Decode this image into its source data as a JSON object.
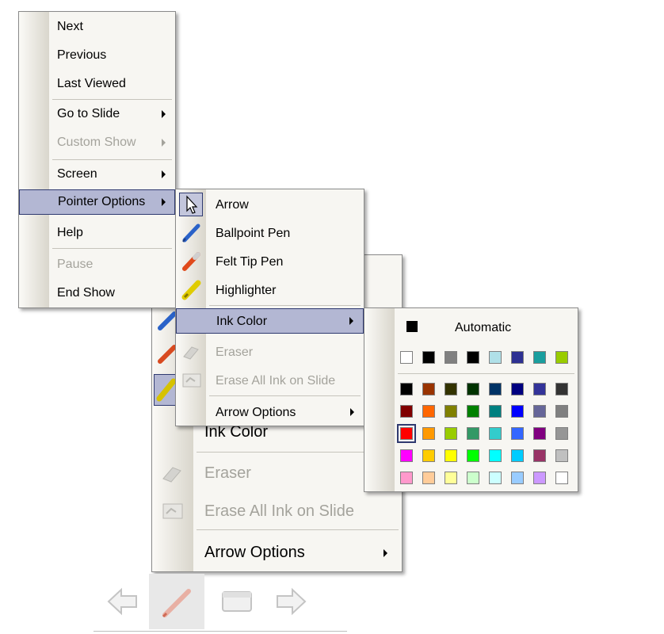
{
  "main_menu": {
    "items": [
      {
        "label": "Next",
        "enabled": true
      },
      {
        "label": "Previous",
        "enabled": true
      },
      {
        "label": "Last Viewed",
        "enabled": true
      },
      {
        "label": "Go to Slide",
        "enabled": true,
        "submenu": true
      },
      {
        "label": "Custom Show",
        "enabled": false,
        "submenu": true
      },
      {
        "label": "Screen",
        "enabled": true,
        "submenu": true
      },
      {
        "label": "Pointer Options",
        "enabled": true,
        "submenu": true,
        "highlighted": true
      },
      {
        "label": "Help",
        "enabled": true
      },
      {
        "label": "Pause",
        "enabled": false
      },
      {
        "label": "End Show",
        "enabled": true
      }
    ]
  },
  "pointer_menu": {
    "items": [
      {
        "label": "Arrow",
        "icon": "arrow-cursor-icon",
        "checked": true
      },
      {
        "label": "Ballpoint Pen",
        "icon": "ballpoint-pen-icon"
      },
      {
        "label": "Felt Tip Pen",
        "icon": "felt-tip-pen-icon"
      },
      {
        "label": "Highlighter",
        "icon": "highlighter-icon"
      },
      {
        "label": "Ink Color",
        "submenu": true,
        "highlighted": true
      },
      {
        "label": "Eraser",
        "icon": "eraser-icon",
        "enabled": false
      },
      {
        "label": "Erase All Ink on Slide",
        "icon": "erase-all-icon",
        "enabled": false
      },
      {
        "label": "Arrow Options",
        "submenu": true
      }
    ]
  },
  "back_menu": {
    "items": [
      {
        "label": "Ink Color",
        "submenu": true
      },
      {
        "label": "Eraser",
        "icon": "eraser-icon",
        "enabled": false
      },
      {
        "label": "Erase All Ink on Slide",
        "icon": "erase-all-icon",
        "enabled": false
      },
      {
        "label": "Arrow Options",
        "submenu": true
      }
    ]
  },
  "ink_color": {
    "automatic_label": "Automatic",
    "automatic_color": "#000000",
    "theme_row": [
      "#ffffff",
      "#000000",
      "#808080",
      "#000000",
      "#b0e0e8",
      "#2e3192",
      "#1a9e9e",
      "#99cc00"
    ],
    "grid": [
      [
        "#000000",
        "#993300",
        "#333300",
        "#003300",
        "#003366",
        "#000080",
        "#333399",
        "#333333"
      ],
      [
        "#800000",
        "#ff6600",
        "#808000",
        "#008000",
        "#008080",
        "#0000ff",
        "#666699",
        "#808080"
      ],
      [
        "#ff0000",
        "#ff9900",
        "#99cc00",
        "#339966",
        "#33cccc",
        "#3366ff",
        "#800080",
        "#969696"
      ],
      [
        "#ff00ff",
        "#ffcc00",
        "#ffff00",
        "#00ff00",
        "#00ffff",
        "#00ccff",
        "#993366",
        "#c0c0c0"
      ],
      [
        "#ff99cc",
        "#ffcc99",
        "#ffff99",
        "#ccffcc",
        "#ccffff",
        "#99ccff",
        "#cc99ff",
        "#ffffff"
      ]
    ],
    "selected": [
      2,
      0
    ]
  },
  "toolbar": {
    "buttons": [
      "previous-slide-icon",
      "pen-icon",
      "menu-icon",
      "next-slide-icon"
    ]
  },
  "colors": {
    "highlight": "#b3b7d3",
    "highlight_border": "#2f3a70",
    "menu_bg": "#f7f6f2"
  }
}
